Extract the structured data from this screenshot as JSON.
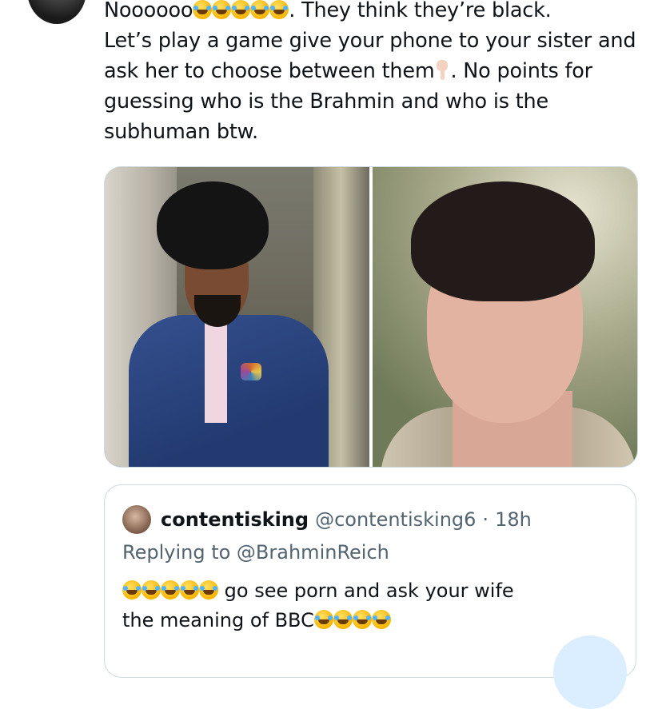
{
  "tweet": {
    "text_prefix": "Noooooo",
    "line1_after_emojis": ". They think they’re black.",
    "line2": "Let’s play a game give your phone to your sister and",
    "line3_before_hand": "ask her to choose between them",
    "line3_after_hand": ". No points for",
    "line4": "guessing who is the Brahmin and who is the",
    "line5": "subhuman btw.",
    "emoji_name": "rolling-on-floor-laughing-emoji",
    "hand_emoji_name": "backhand-index-pointing-down-emoji"
  },
  "quoted_tweet": {
    "display_name": "contentisking",
    "handle": "@contentisking6",
    "separator": "·",
    "time": "18h",
    "replying_to": "Replying to @BrahminReich",
    "text_part1": "go see porn and ask your wife",
    "text_part2": "the meaning of BBC"
  },
  "colors": {
    "text_primary": "#0f1419",
    "text_secondary": "#536471",
    "border": "#cfd9de"
  }
}
